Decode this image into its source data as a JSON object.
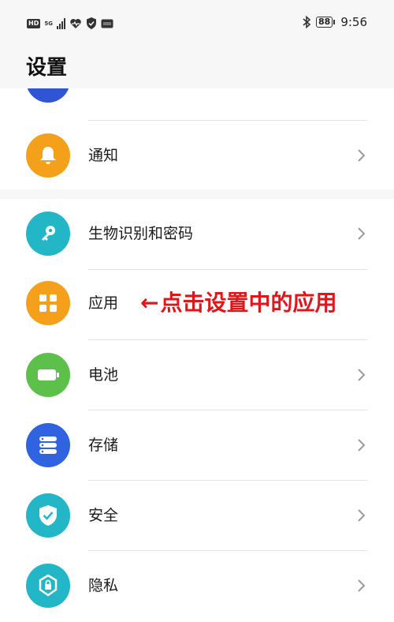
{
  "status_bar": {
    "left_badge": "HD",
    "network": "5G",
    "battery": "88",
    "time": "9:56"
  },
  "page": {
    "title": "设置"
  },
  "menu": {
    "items": [
      {
        "label": "通知",
        "icon": "bell-icon",
        "color": "#f4a01a"
      },
      {
        "label": "生物识别和密码",
        "icon": "key-icon",
        "color": "#22b6c6"
      },
      {
        "label": "应用",
        "icon": "apps-grid-icon",
        "color": "#f4a01a"
      },
      {
        "label": "电池",
        "icon": "battery-icon",
        "color": "#5cc04a"
      },
      {
        "label": "存储",
        "icon": "storage-icon",
        "color": "#2f63e0"
      },
      {
        "label": "安全",
        "icon": "shield-icon",
        "color": "#22b6c6"
      },
      {
        "label": "隐私",
        "icon": "privacy-lock-icon",
        "color": "#22b6c6"
      }
    ]
  },
  "annotation": {
    "arrow": "←",
    "text": "点击设置中的应用",
    "color": "#e0161b"
  }
}
